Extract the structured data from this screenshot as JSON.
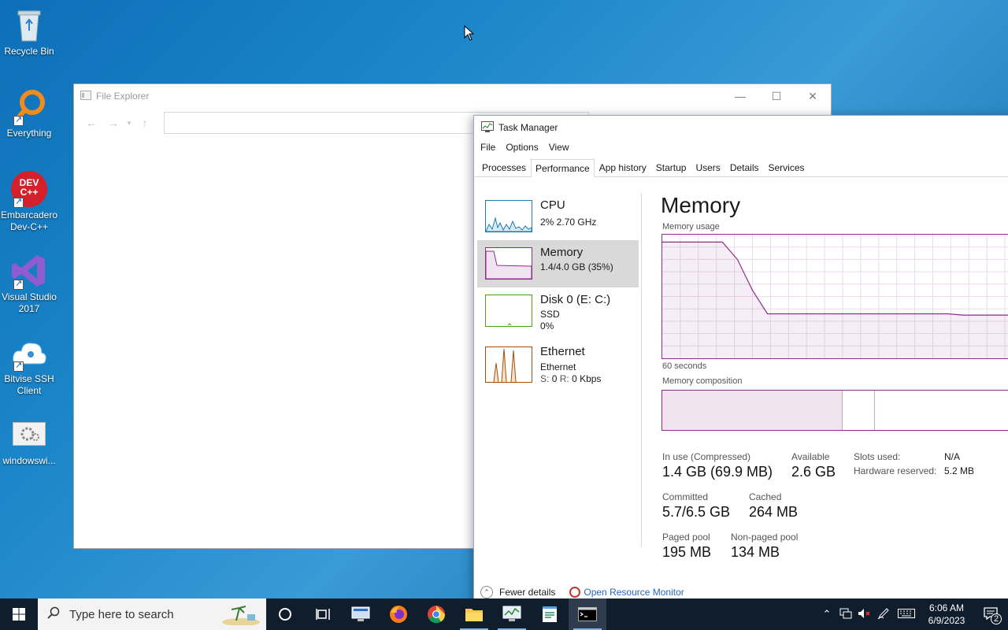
{
  "desktop": {
    "icons": [
      {
        "label": "Recycle Bin"
      },
      {
        "label": "Everything"
      },
      {
        "label": "Embarcadero Dev-C++"
      },
      {
        "label": "Visual Studio 2017"
      },
      {
        "label": "Bitvise SSH Client"
      },
      {
        "label": "windowswi..."
      }
    ],
    "devcpp_logo": "DEV C++"
  },
  "explorer": {
    "title": "File Explorer"
  },
  "taskmgr": {
    "title": "Task Manager",
    "menu": [
      "File",
      "Options",
      "View"
    ],
    "tabs": [
      "Processes",
      "Performance",
      "App history",
      "Startup",
      "Users",
      "Details",
      "Services"
    ],
    "active_tab": "Performance",
    "resources": [
      {
        "name": "CPU",
        "line1": "2% 2.70 GHz",
        "color": "#1a7ab0"
      },
      {
        "name": "Memory",
        "line1": "1.4/4.0 GB (35%)",
        "color": "#8b2b8b"
      },
      {
        "name": "Disk 0 (E: C:)",
        "line1": "SSD",
        "line2": "0%",
        "color": "#4da60c"
      },
      {
        "name": "Ethernet",
        "line1": "Ethernet",
        "line2_label": "S:",
        "line2_s": "0",
        "line2_r_label": "R:",
        "line2_r": "0 Kbps",
        "color": "#a74f01"
      }
    ],
    "memory": {
      "heading": "Memory",
      "usage_label": "Memory usage",
      "time_label": "60 seconds",
      "composition_label": "Memory composition",
      "usage_curve_pct": [
        94,
        94,
        94,
        94,
        94,
        80,
        55,
        36,
        36,
        36,
        36,
        36,
        36,
        36,
        36,
        36,
        36,
        36,
        36,
        36,
        35,
        35,
        35,
        35,
        35
      ],
      "composition": {
        "in_use_fraction": 0.5,
        "modified_fraction": 0.09
      },
      "stats": {
        "in_use_label": "In use (Compressed)",
        "in_use": "1.4 GB (69.9 MB)",
        "available_label": "Available",
        "available": "2.6 GB",
        "committed_label": "Committed",
        "committed": "5.7/6.5 GB",
        "cached_label": "Cached",
        "cached": "264 MB",
        "paged_label": "Paged pool",
        "paged": "195 MB",
        "nonpaged_label": "Non-paged pool",
        "nonpaged": "134 MB",
        "slots_label": "Slots used:",
        "slots": "N/A",
        "hw_reserved_label": "Hardware reserved:",
        "hw_reserved": "5.2 MB"
      }
    },
    "footer": {
      "fewer_details": "Fewer details",
      "open_monitor": "Open Resource Monitor"
    }
  },
  "taskbar": {
    "search_placeholder": "Type here to search",
    "time": "6:06 AM",
    "date": "6/9/2023",
    "notification_count": "2"
  }
}
